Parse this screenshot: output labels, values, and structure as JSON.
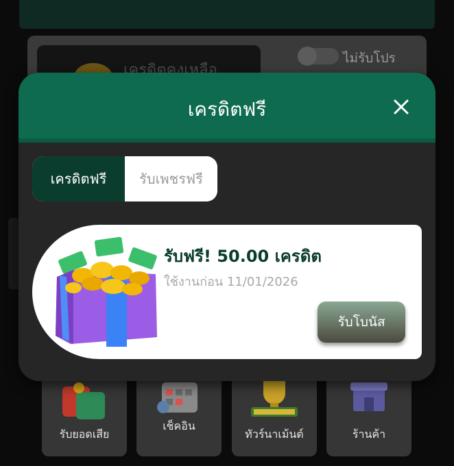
{
  "background": {
    "credit_label": "เครดิตคงเหลือ",
    "promo_toggle": {
      "label": "ไม่รับโปร",
      "enabled": false
    },
    "menu": [
      {
        "label": "รับยอดเสีย",
        "icon": "loss-rebate-icon"
      },
      {
        "label": "เช็คอิน",
        "icon": "calendar-checkin-icon"
      },
      {
        "label": "ทัวร์นาเม้นต์",
        "icon": "tournament-trophy-icon"
      },
      {
        "label": "ร้านค้า",
        "icon": "shop-icon"
      }
    ]
  },
  "modal": {
    "title": "เครดิตฟรี",
    "close_icon": "close-icon",
    "tabs": [
      {
        "label": "เครดิตฟรี",
        "active": true
      },
      {
        "label": "รับเพชรฟรี",
        "active": false
      }
    ],
    "bonus": {
      "title": "รับฟรี! 50.00 เครดิต",
      "expiry": "ใช้งานก่อน 11/01/2026",
      "icon": "gift-box-icon",
      "claim_label": "รับโบนัส"
    }
  },
  "colors": {
    "header_green": "#0f6b4f",
    "active_tab": "#0b3d2f",
    "bonus_title": "#0b3d2f"
  }
}
